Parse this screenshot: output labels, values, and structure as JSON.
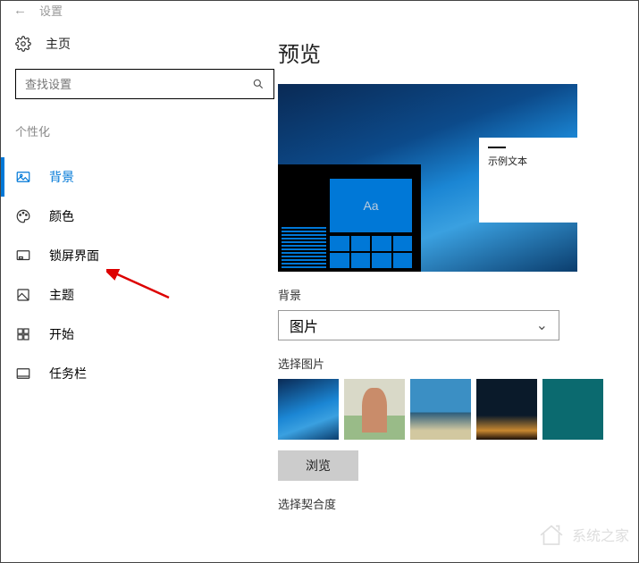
{
  "header": {
    "title": "设置"
  },
  "sidebar": {
    "home": "主页",
    "search_placeholder": "查找设置",
    "section": "个性化",
    "items": [
      {
        "label": "背景"
      },
      {
        "label": "颜色"
      },
      {
        "label": "锁屏界面"
      },
      {
        "label": "主题"
      },
      {
        "label": "开始"
      },
      {
        "label": "任务栏"
      }
    ]
  },
  "content": {
    "preview_title": "预览",
    "sample_text": "示例文本",
    "tile_text": "Aa",
    "background_label": "背景",
    "background_dropdown": "图片",
    "choose_picture_label": "选择图片",
    "browse_button": "浏览",
    "fit_label_partial": "选择契合度"
  },
  "watermark": "系统之家"
}
